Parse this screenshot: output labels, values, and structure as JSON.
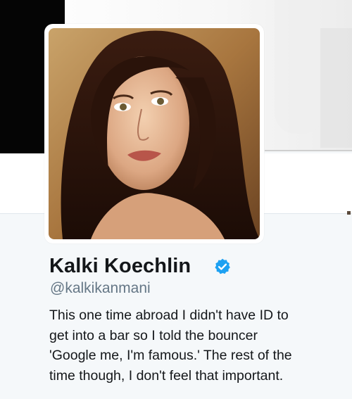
{
  "profile": {
    "name": "Kalki Koechlin",
    "handle": "@kalkikanmani",
    "verified": true,
    "bio_lines": [
      "This one time abroad I didn't have ID to",
      "get into a bar so I told the bouncer",
      "'Google me, I'm famous.' The rest of the",
      "time though, I don't feel that important."
    ]
  },
  "icons": {
    "verified": "verified-badge-icon"
  },
  "colors": {
    "accent": "#1da1f2",
    "text": "#14171a",
    "secondary_text": "#657786",
    "background": "#f5f8fa"
  }
}
